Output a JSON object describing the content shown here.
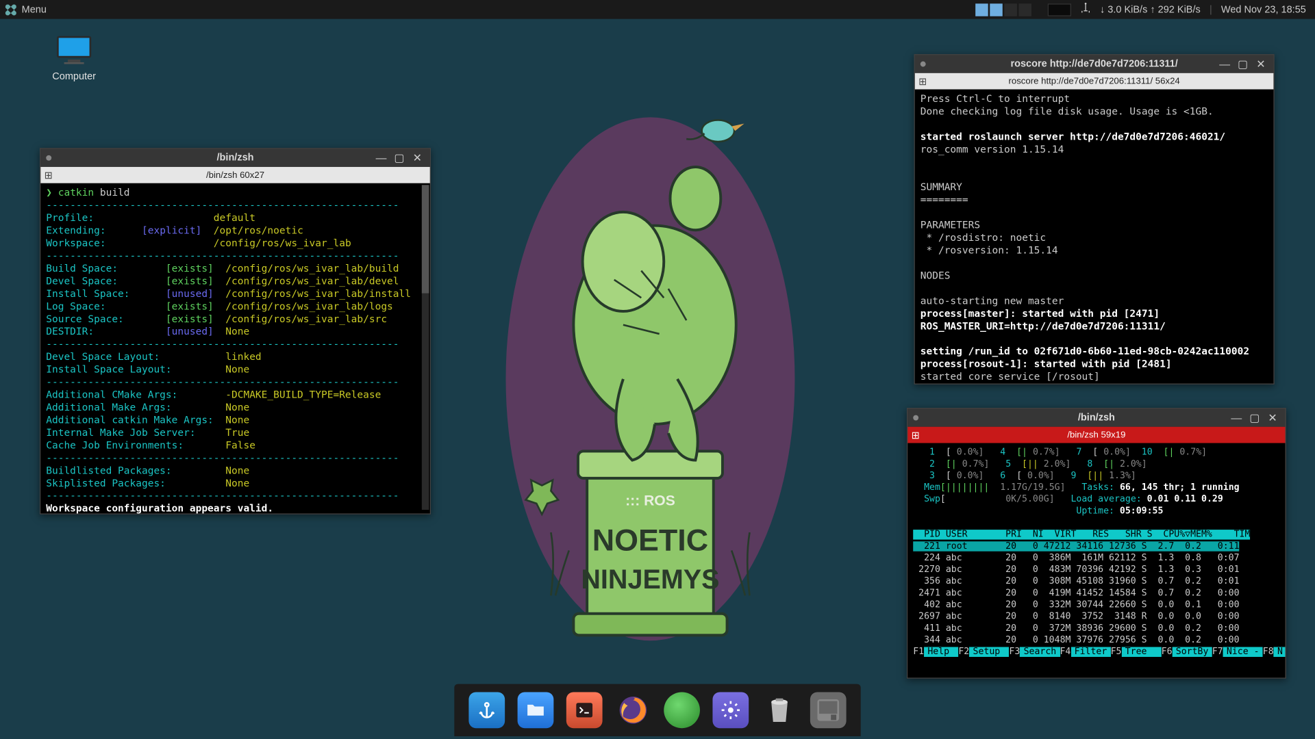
{
  "panel": {
    "menu_label": "Menu",
    "net_down": "3.0 KiB/s",
    "net_up": "292 KiB/s",
    "clock": "Wed Nov 23, 18:55"
  },
  "desktop": {
    "computer_label": "Computer"
  },
  "win_catkin": {
    "title": "/bin/zsh",
    "tab": "/bin/zsh 60x27",
    "prompt": "❯ ",
    "cmd_catkin": "catkin",
    "cmd_build": " build",
    "dashes": "-----------------------------------------------------------",
    "rows": [
      {
        "k": "Profile:",
        "tag": "",
        "v": "default"
      },
      {
        "k": "Extending:",
        "tag": "[explicit]",
        "v": "/opt/ros/noetic"
      },
      {
        "k": "Workspace:",
        "tag": "",
        "v": "/config/ros/ws_ivar_lab"
      }
    ],
    "rows2": [
      {
        "k": "Build Space:",
        "tag": "[exists]",
        "v": "/config/ros/ws_ivar_lab/build"
      },
      {
        "k": "Devel Space:",
        "tag": "[exists]",
        "v": "/config/ros/ws_ivar_lab/devel"
      },
      {
        "k": "Install Space:",
        "tag": "[unused]",
        "v": "/config/ros/ws_ivar_lab/install"
      },
      {
        "k": "Log Space:",
        "tag": "[exists]",
        "v": "/config/ros/ws_ivar_lab/logs"
      },
      {
        "k": "Source Space:",
        "tag": "[exists]",
        "v": "/config/ros/ws_ivar_lab/src"
      },
      {
        "k": "DESTDIR:",
        "tag": "[unused]",
        "v": "None"
      }
    ],
    "rows3": [
      {
        "k": "Devel Space Layout:",
        "v": "linked"
      },
      {
        "k": "Install Space Layout:",
        "v": "None"
      }
    ],
    "rows4": [
      {
        "k": "Additional CMake Args:",
        "v": "-DCMAKE_BUILD_TYPE=Release"
      },
      {
        "k": "Additional Make Args:",
        "v": "None"
      },
      {
        "k": "Additional catkin Make Args:",
        "v": "None"
      },
      {
        "k": "Internal Make Job Server:",
        "v": "True"
      },
      {
        "k": "Cache Job Environments:",
        "v": "False"
      }
    ],
    "rows5": [
      {
        "k": "Buildlisted Packages:",
        "v": "None"
      },
      {
        "k": "Skiplisted Packages:",
        "v": "None"
      }
    ],
    "valid": "Workspace configuration appears valid."
  },
  "win_roscore": {
    "title": "roscore http://de7d0e7d7206:11311/",
    "tab": "roscore http://de7d0e7d7206:11311/ 56x24",
    "lines": [
      "Press Ctrl-C to interrupt",
      "Done checking log file disk usage. Usage is <1GB.",
      "",
      "**started roslaunch server http://de7d0e7d7206:46021/**",
      "ros_comm version 1.15.14",
      "",
      "",
      "SUMMARY",
      "========",
      "",
      "PARAMETERS",
      " * /rosdistro: noetic",
      " * /rosversion: 1.15.14",
      "",
      "NODES",
      "",
      "auto-starting new master",
      "**process[master]: started with pid [2471]**",
      "**ROS_MASTER_URI=http://de7d0e7d7206:11311/**",
      "",
      "**setting /run_id to 02f671d0-6b60-11ed-98cb-0242ac110002**",
      "**process[rosout-1]: started with pid [2481]**",
      "started core service [/rosout]"
    ]
  },
  "win_htop": {
    "title": "/bin/zsh",
    "tab": "/bin/zsh 59x19",
    "cpus": [
      {
        "n": "1",
        "bar": "[",
        "pct": " 0.0",
        "c": 0
      },
      {
        "n": "4",
        "bar": "[|",
        "pct": " 0.7",
        "c": 1
      },
      {
        "n": "7",
        "bar": "[",
        "pct": " 0.0",
        "c": 0
      },
      {
        "n": "10",
        "bar": "[|",
        "pct": " 0.7",
        "c": 1
      },
      {
        "n": "2",
        "bar": "[|",
        "pct": " 0.7",
        "c": 1
      },
      {
        "n": "5",
        "bar": "[||",
        "pct": "2.0",
        "c": 2
      },
      {
        "n": "8",
        "bar": "[|",
        "pct": " 2.0",
        "c": 1
      },
      {
        "n": "3",
        "bar": "[",
        "pct": " 0.0",
        "c": 0
      },
      {
        "n": "6",
        "bar": "[",
        "pct": " 0.0",
        "c": 0
      },
      {
        "n": "9",
        "bar": "[||",
        "pct": "1.3",
        "c": 2
      }
    ],
    "mem_label": "Mem",
    "mem_bar": "[||||||||",
    "mem_val": "1.17G/19.5G",
    "swp_label": "Swp",
    "swp_bar": "[",
    "swp_val": "0K/5.00G",
    "tasks": "Tasks: ",
    "tasks_v": "66, 145 thr; 1 running",
    "load": "Load average: ",
    "load_v": "0.01 0.11 0.29",
    "uptime": "Uptime: ",
    "uptime_v": "05:09:55",
    "header": "  PID USER       PRI  NI  VIRT   RES   SHR S  CPU%▽MEM%    TIM",
    "procs": [
      {
        "pid": "221",
        "user": "root",
        "pri": "20",
        "ni": "0",
        "virt": "47212",
        "res": "34116",
        "shr": "12736",
        "s": "S",
        "cpu": "2.7",
        "mem": "0.2",
        "time": "0:11",
        "sel": true
      },
      {
        "pid": "224",
        "user": "abc",
        "pri": "20",
        "ni": "0",
        "virt": "386M",
        "res": "161M",
        "shr": "62112",
        "s": "S",
        "cpu": "1.3",
        "mem": "0.8",
        "time": "0:07"
      },
      {
        "pid": "2270",
        "user": "abc",
        "pri": "20",
        "ni": "0",
        "virt": "483M",
        "res": "70396",
        "shr": "42192",
        "s": "S",
        "cpu": "1.3",
        "mem": "0.3",
        "time": "0:01"
      },
      {
        "pid": "356",
        "user": "abc",
        "pri": "20",
        "ni": "0",
        "virt": "308M",
        "res": "45108",
        "shr": "31960",
        "s": "S",
        "cpu": "0.7",
        "mem": "0.2",
        "time": "0:01"
      },
      {
        "pid": "2471",
        "user": "abc",
        "pri": "20",
        "ni": "0",
        "virt": "419M",
        "res": "41452",
        "shr": "14584",
        "s": "S",
        "cpu": "0.7",
        "mem": "0.2",
        "time": "0:00"
      },
      {
        "pid": "402",
        "user": "abc",
        "pri": "20",
        "ni": "0",
        "virt": "332M",
        "res": "30744",
        "shr": "22660",
        "s": "S",
        "cpu": "0.0",
        "mem": "0.1",
        "time": "0:00"
      },
      {
        "pid": "2697",
        "user": "abc",
        "pri": "20",
        "ni": "0",
        "virt": "8140",
        "res": "3752",
        "shr": "3148",
        "s": "R",
        "cpu": "0.0",
        "mem": "0.0",
        "time": "0:00"
      },
      {
        "pid": "411",
        "user": "abc",
        "pri": "20",
        "ni": "0",
        "virt": "372M",
        "res": "38936",
        "shr": "29600",
        "s": "S",
        "cpu": "0.0",
        "mem": "0.2",
        "time": "0:00"
      },
      {
        "pid": "344",
        "user": "abc",
        "pri": "20",
        "ni": "0",
        "virt": "1048M",
        "res": "37976",
        "shr": "27956",
        "s": "S",
        "cpu": "0.0",
        "mem": "0.2",
        "time": "0:00"
      }
    ],
    "fkeys": [
      {
        "k": "F1",
        "l": "Help "
      },
      {
        "k": "F2",
        "l": "Setup "
      },
      {
        "k": "F3",
        "l": "Search"
      },
      {
        "k": "F4",
        "l": "Filter"
      },
      {
        "k": "F5",
        "l": "Tree  "
      },
      {
        "k": "F6",
        "l": "SortBy"
      },
      {
        "k": "F7",
        "l": "Nice -"
      },
      {
        "k": "F8",
        "l": "N"
      }
    ]
  },
  "dock": {
    "items": [
      "anchor",
      "files",
      "terminal",
      "firefox",
      "green-orb",
      "settings",
      "trash",
      "disk"
    ]
  },
  "wallpaper": {
    "text_ros": "::: ROS",
    "text_noetic": "NOETIC",
    "text_ninjemys": "NINJEMYS"
  }
}
